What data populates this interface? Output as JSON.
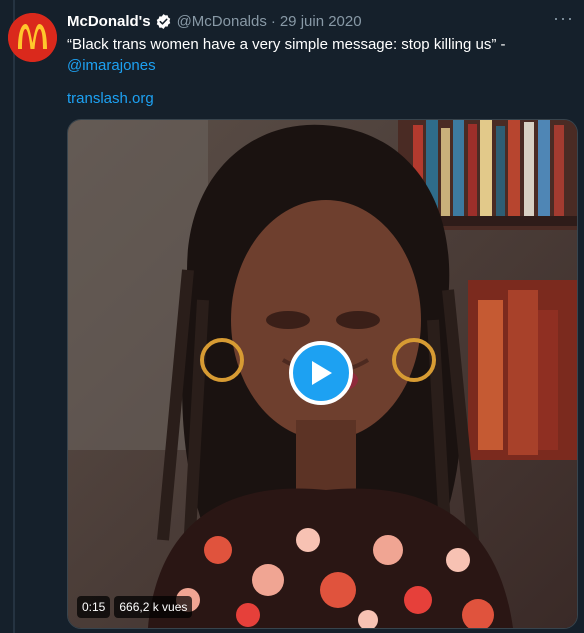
{
  "tweet": {
    "author_name": "McDonald's",
    "handle": "@McDonalds",
    "separator": "·",
    "date": "29 juin 2020",
    "text": "“Black trans women have a very simple message: stop killing us” -",
    "mention": "@imarajones",
    "link": "translash.org",
    "more_label": "···"
  },
  "video": {
    "duration": "0:15",
    "views": "666,2 k vues"
  },
  "colors": {
    "background": "#15202b",
    "accent": "#1da1f2",
    "muted": "#8899a6",
    "brand_red": "#da291c",
    "brand_gold": "#ffc72c"
  }
}
